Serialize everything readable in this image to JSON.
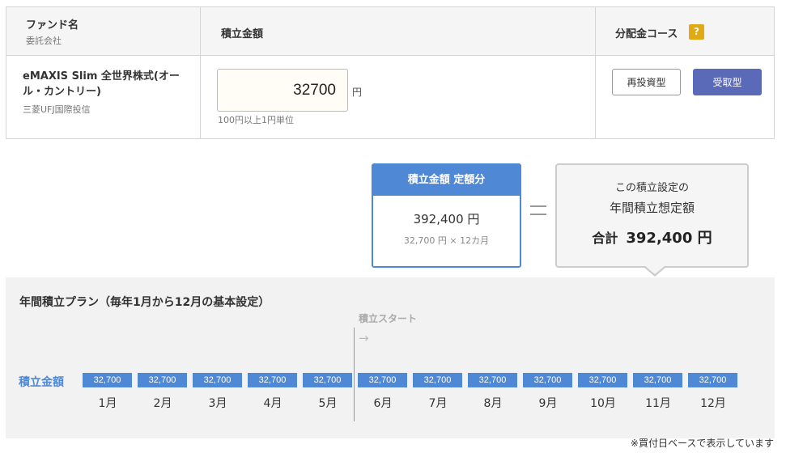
{
  "table": {
    "header": {
      "fund": "ファンド名",
      "fund_sub": "委託会社",
      "amount": "積立金額",
      "course": "分配金コース",
      "help": "?"
    },
    "fund_name": "eMAXIS Slim 全世界株式(オール・カントリー)",
    "company": "三菱UFJ国際投信",
    "amount_value": "32700",
    "amount_unit": "円",
    "amount_hint": "100円以上1円単位",
    "course_buttons": {
      "reinvest": "再投資型",
      "receive": "受取型"
    },
    "selected_course": "受取型"
  },
  "summary": {
    "fixed_header": "積立金額 定額分",
    "fixed_value": "392,400 円",
    "fixed_calc": "32,700 円 × 12カ月",
    "total_line1": "この積立設定の",
    "total_line2": "年間積立想定額",
    "total_label": "合計",
    "total_value": "392,400 円"
  },
  "plan": {
    "title": "年間積立プラン（毎年1月から12月の基本設定）",
    "start_label": "積立スタート",
    "start_arrow": "→",
    "row_label": "積立金額",
    "months": [
      {
        "label": "1月",
        "amount": "32,700"
      },
      {
        "label": "2月",
        "amount": "32,700"
      },
      {
        "label": "3月",
        "amount": "32,700"
      },
      {
        "label": "4月",
        "amount": "32,700"
      },
      {
        "label": "5月",
        "amount": "32,700"
      },
      {
        "label": "6月",
        "amount": "32,700"
      },
      {
        "label": "7月",
        "amount": "32,700"
      },
      {
        "label": "8月",
        "amount": "32,700"
      },
      {
        "label": "9月",
        "amount": "32,700"
      },
      {
        "label": "10月",
        "amount": "32,700"
      },
      {
        "label": "11月",
        "amount": "32,700"
      },
      {
        "label": "12月",
        "amount": "32,700"
      }
    ]
  },
  "note": "※買付日ベースで表示しています",
  "colors": {
    "accent": "#4f89d6",
    "selected_button": "#5b6ab8",
    "help_icon": "#e2a917"
  }
}
